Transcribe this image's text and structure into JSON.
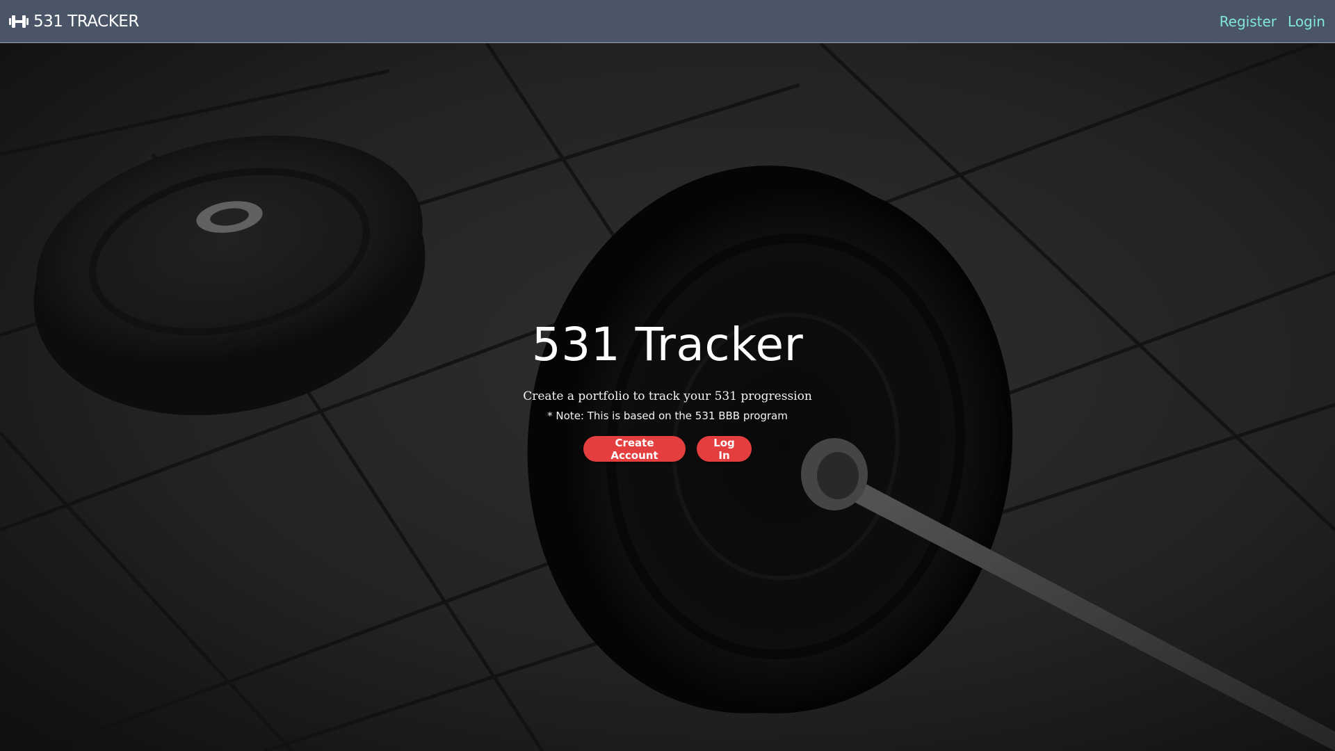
{
  "navbar": {
    "brand_label": "531 TRACKER",
    "brand_icon": "dumbbell-icon",
    "links": {
      "register": "Register",
      "login": "Login"
    },
    "colors": {
      "background": "#4a5568",
      "link": "#81e6d9"
    }
  },
  "hero": {
    "title": "531 Tracker",
    "subtitle": "Create a portfolio to track your 531 progression",
    "note": "* Note: This is based on the 531 BBB program",
    "buttons": {
      "create_account": "Create Account",
      "log_in": "Log In"
    },
    "colors": {
      "button": "#e53e3e"
    }
  }
}
